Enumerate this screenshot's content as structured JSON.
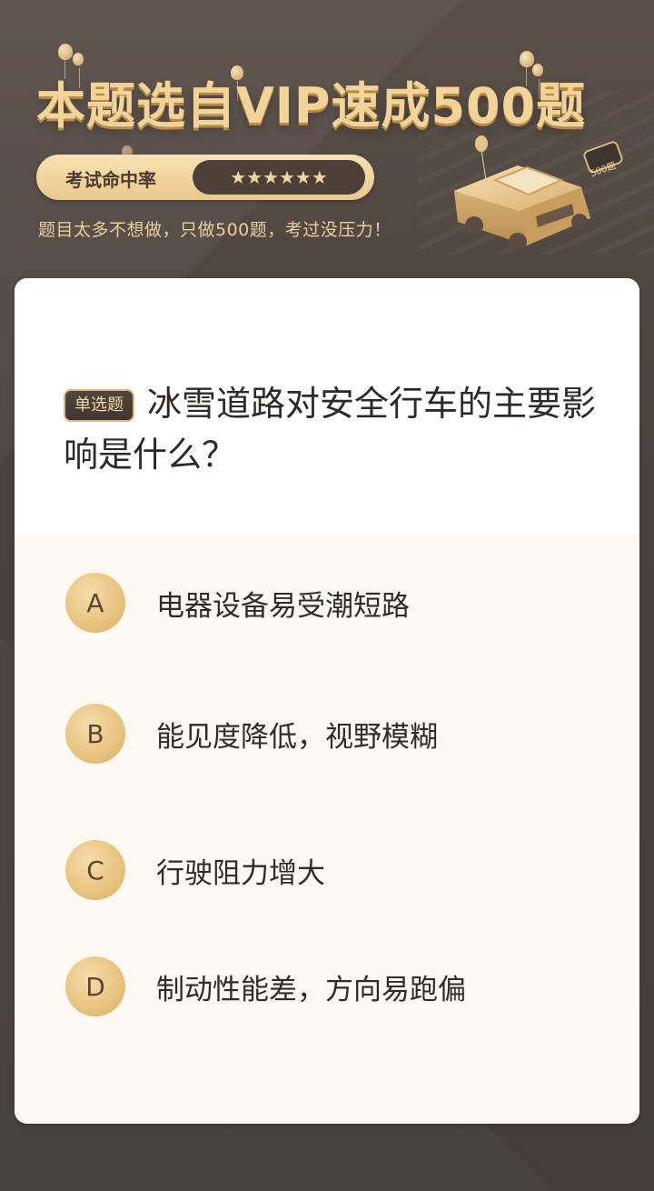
{
  "header": {
    "title": "本题选自VIP速成500题",
    "rate_label": "考试命中率",
    "rate_stars": "★★★★★★",
    "subtitle": "题目太多不想做，只做500题，考过没压力！",
    "car_tag": "500题",
    "accent_color": "#f2d49a"
  },
  "question": {
    "type_badge": "单选题",
    "text": "冰雪道路对安全行车的主要影响是什么？"
  },
  "options": [
    {
      "letter": "A",
      "text": "电器设备易受潮短路"
    },
    {
      "letter": "B",
      "text": "能见度降低，视野模糊"
    },
    {
      "letter": "C",
      "text": "行驶阻力增大"
    },
    {
      "letter": "D",
      "text": "制动性能差，方向易跑偏"
    }
  ]
}
